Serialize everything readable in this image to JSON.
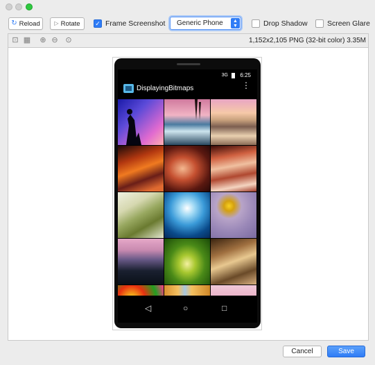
{
  "window": {
    "traffic_lights": [
      "close",
      "minimize",
      "zoom"
    ]
  },
  "toolbar": {
    "reload_label": "Reload",
    "rotate_label": "Rotate",
    "frame_screenshot": {
      "label": "Frame Screenshot",
      "checked": true
    },
    "device_select": {
      "value": "Generic Phone"
    },
    "drop_shadow": {
      "label": "Drop Shadow",
      "checked": false
    },
    "screen_glare": {
      "label": "Screen Glare",
      "checked": false
    }
  },
  "subbar": {
    "icons": [
      "fit-screen-icon",
      "actual-size-icon",
      "zoom-in-icon",
      "zoom-out-icon",
      "zoom-reset-icon"
    ],
    "image_info": "1,152x2,105 PNG (32-bit color) 3.35M"
  },
  "phone": {
    "status_time": "6:25",
    "status_signal": "3G",
    "app_title": "DisplayingBitmaps",
    "gallery_tiles": [
      "silhouette-photographer",
      "icy-lake-sunset",
      "beach-sunset",
      "canyon-orange",
      "canyon-swirl",
      "canyon-layers",
      "green-leaf-closeup",
      "blue-sky-wave",
      "yellow-flower",
      "lake-dusk",
      "caterpillar",
      "chess-pieces",
      "colorful-flowers",
      "orange-building",
      "pink-clouds"
    ],
    "nav": [
      "back-icon",
      "home-icon",
      "recents-icon"
    ]
  },
  "footer": {
    "cancel_label": "Cancel",
    "save_label": "Save"
  },
  "colors": {
    "accent": "#2f7cf6",
    "window_bg": "#ececec"
  }
}
